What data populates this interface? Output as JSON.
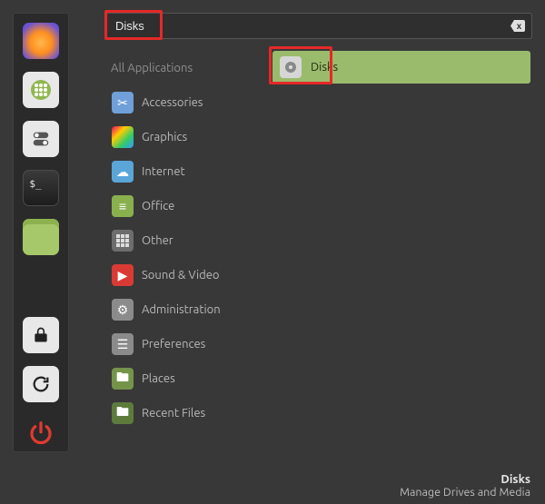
{
  "accent": "#9bbb6c",
  "highlight_color": "#e62828",
  "search": {
    "value": "Disks",
    "clear_glyph": "x"
  },
  "dock": [
    {
      "name": "firefox",
      "tip": "Firefox Web Browser"
    },
    {
      "name": "app-grid",
      "tip": "Application Menu"
    },
    {
      "name": "switcher",
      "tip": "Window List"
    },
    {
      "name": "terminal",
      "tip": "Terminal"
    },
    {
      "name": "files",
      "tip": "Files"
    },
    {
      "name": "lock",
      "tip": "Lock Screen"
    },
    {
      "name": "reload",
      "tip": "Session"
    },
    {
      "name": "power",
      "tip": "Quit"
    }
  ],
  "categories": {
    "header": "All Applications",
    "items": [
      {
        "label": "Accessories",
        "icon": "scissors"
      },
      {
        "label": "Graphics",
        "icon": "palette"
      },
      {
        "label": "Internet",
        "icon": "globe"
      },
      {
        "label": "Office",
        "icon": "page"
      },
      {
        "label": "Other",
        "icon": "grid"
      },
      {
        "label": "Sound & Video",
        "icon": "play"
      },
      {
        "label": "Administration",
        "icon": "gear"
      },
      {
        "label": "Preferences",
        "icon": "sliders"
      },
      {
        "label": "Places",
        "icon": "folder"
      },
      {
        "label": "Recent Files",
        "icon": "folder-clock"
      }
    ]
  },
  "results": [
    {
      "label": "Disks",
      "icon": "disk",
      "selected": true
    }
  ],
  "footer": {
    "title": "Disks",
    "desc": "Manage Drives and Media"
  }
}
